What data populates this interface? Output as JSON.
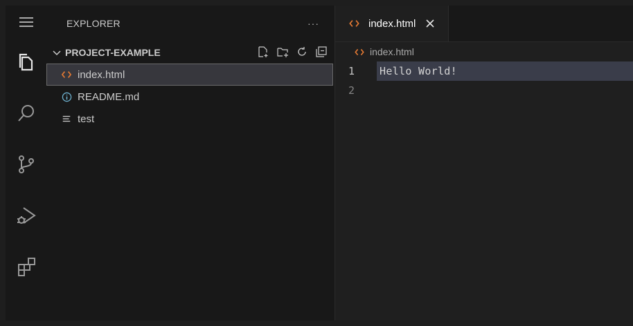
{
  "activity_bar": {
    "icons": [
      "menu-icon",
      "explorer-icon",
      "search-icon",
      "source-control-icon",
      "run-debug-icon",
      "extensions-icon"
    ]
  },
  "sidebar": {
    "title": "EXPLORER",
    "more": "···",
    "section_label": "PROJECT-EXAMPLE",
    "section_actions": [
      "new-file-icon",
      "new-folder-icon",
      "refresh-icon",
      "collapse-all-icon"
    ],
    "files": [
      {
        "name": "index.html",
        "icon": "html-icon",
        "active": true
      },
      {
        "name": "README.md",
        "icon": "info-icon",
        "active": false
      },
      {
        "name": "test",
        "icon": "text-file-icon",
        "active": false
      }
    ]
  },
  "editor": {
    "tab_label": "index.html",
    "breadcrumb": "index.html",
    "lines": [
      {
        "number": "1",
        "text": "Hello World!"
      },
      {
        "number": "2",
        "text": ""
      }
    ]
  },
  "colors": {
    "html_icon": "#e37933",
    "info_icon": "#6fb3d2",
    "background": "#1e1e1e",
    "sidebar": "#181818"
  }
}
